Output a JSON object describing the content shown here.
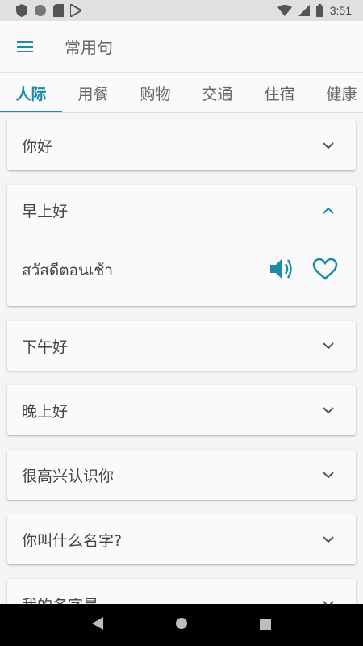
{
  "status_bar": {
    "time": "3:51"
  },
  "app_bar": {
    "title": "常用句"
  },
  "tabs": [
    {
      "label": "人际",
      "active": true
    },
    {
      "label": "用餐",
      "active": false
    },
    {
      "label": "购物",
      "active": false
    },
    {
      "label": "交通",
      "active": false
    },
    {
      "label": "住宿",
      "active": false
    },
    {
      "label": "健康",
      "active": false
    }
  ],
  "phrases": [
    {
      "text": "你好",
      "expanded": false
    },
    {
      "text": "早上好",
      "expanded": true,
      "translation": "สวัสดีตอนเช้า"
    },
    {
      "text": "下午好",
      "expanded": false
    },
    {
      "text": "晚上好",
      "expanded": false
    },
    {
      "text": "很高兴认识你",
      "expanded": false
    },
    {
      "text": "你叫什么名字?",
      "expanded": false
    },
    {
      "text": "我的名字是",
      "expanded": false
    }
  ],
  "colors": {
    "accent": "#1a8ca6"
  }
}
